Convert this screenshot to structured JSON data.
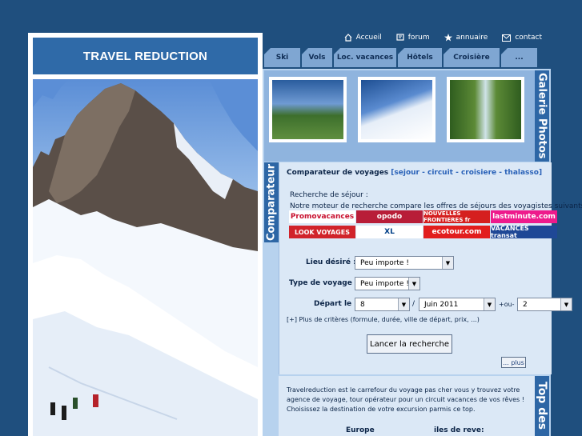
{
  "site": {
    "title": "TRAVEL REDUCTION"
  },
  "topnav": [
    {
      "label": "Accueil",
      "icon": "home-icon"
    },
    {
      "label": "forum",
      "icon": "forum-icon"
    },
    {
      "label": "annuaire",
      "icon": "star-icon"
    },
    {
      "label": "contact",
      "icon": "mail-icon"
    }
  ],
  "tabs": [
    "Ski",
    "Vols",
    "Loc. vacances",
    "Hôtels",
    "Croisière",
    "..."
  ],
  "gallery": {
    "label": "Galerie Photos"
  },
  "comparateur": {
    "side_label": "Comparateur",
    "title_prefix": "Comparateur de voyages",
    "title_links": "[sejour - circuit - croisiere - thalasso]",
    "intro_line1": "Recherche de séjour :",
    "intro_line2": "Notre moteur de recherche compare les offres de séjours des voyagistes suivants :",
    "logos": [
      {
        "name": "Promovacances",
        "bg": "#ffffff",
        "color": "#c8102e"
      },
      {
        "name": "opodo",
        "bg": "#b81d38",
        "color": "#ffffff"
      },
      {
        "name": "NOUVELLES FRONTIERES fr",
        "bg": "#d51f1f",
        "color": "#ffffff"
      },
      {
        "name": "lastminute.com",
        "bg": "#ee1a8c",
        "color": "#ffffff"
      },
      {
        "name": "LOOK VOYAGES",
        "bg": "#d1232a",
        "color": "#ffffff"
      },
      {
        "name": "XL",
        "bg": "#ffffff",
        "color": "#003f87"
      },
      {
        "name": "ecotour.com",
        "bg": "#e21d1d",
        "color": "#ffffff"
      },
      {
        "name": "VACANCES transat",
        "bg": "#1f4896",
        "color": "#ffffff"
      }
    ],
    "lieu_label": "Lieu désiré :",
    "lieu_value": "Peu importe !",
    "type_label": "Type de voyage :",
    "type_value": "Peu importe !",
    "depart_label": "Départ le :",
    "depart_day": "8",
    "depart_sep": "/",
    "depart_month": "Juin 2011",
    "ou_label": "+ou-",
    "plus_minus_value": "2",
    "criteria": "[+] Plus de critères (formule, durée, ville de départ, prix, ...)",
    "submit_label": "Lancer la recherche",
    "more_label": "... plus"
  },
  "top_dest": {
    "side_label": "Top des",
    "text": "Travelreduction est le carrefour du voyage pas cher vous y trouvez votre agence de voyage, tour opérateur pour un circuit vacances de vos rêves ! Choisissez la destination de votre excursion parmis ce top.",
    "col1": "Europe",
    "col2": "iles de reve:"
  }
}
